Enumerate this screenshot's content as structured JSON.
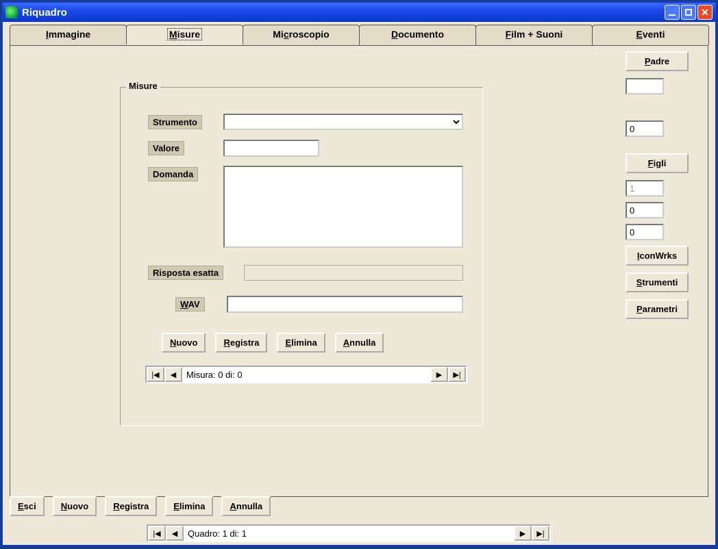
{
  "window": {
    "title": "Riquadro"
  },
  "tabs": [
    {
      "label": "Immagine",
      "ukey": "I"
    },
    {
      "label": "Misure",
      "ukey": "M",
      "active": true
    },
    {
      "label": "Microscopio",
      "ukey": "c"
    },
    {
      "label": "Documento",
      "ukey": "D"
    },
    {
      "label": "Film + Suoni",
      "ukey": "F"
    },
    {
      "label": "Eventi",
      "ukey": "E"
    }
  ],
  "group": {
    "title": "Misure",
    "strumento_label": "Strumento",
    "strumento_value": "",
    "valore_label": "Valore",
    "valore_value": "",
    "domanda_label": "Domanda",
    "domanda_value": "",
    "risposta_label": "Risposta esatta",
    "risposta_value": "",
    "wav_label": "WAV",
    "wav_value": "",
    "buttons": {
      "nuovo": "Nuovo",
      "registra": "Registra",
      "elimina": "Elimina",
      "annulla": "Annulla"
    },
    "nav_text": "Misura: 0 di: 0"
  },
  "right": {
    "padre": "Padre",
    "padre_field": "",
    "zero_field": "0",
    "figli": "Figli",
    "f1": "1",
    "f2": "0",
    "f3": "0",
    "iconwrks": "IconWrks",
    "strumenti": "Strumenti",
    "parametri": "Parametri"
  },
  "bottom": {
    "esci": "Esci",
    "nuovo": "Nuovo",
    "registra": "Registra",
    "elimina": "Elimina",
    "annulla": "Annulla",
    "nav_text": "Quadro: 1 di: 1"
  }
}
